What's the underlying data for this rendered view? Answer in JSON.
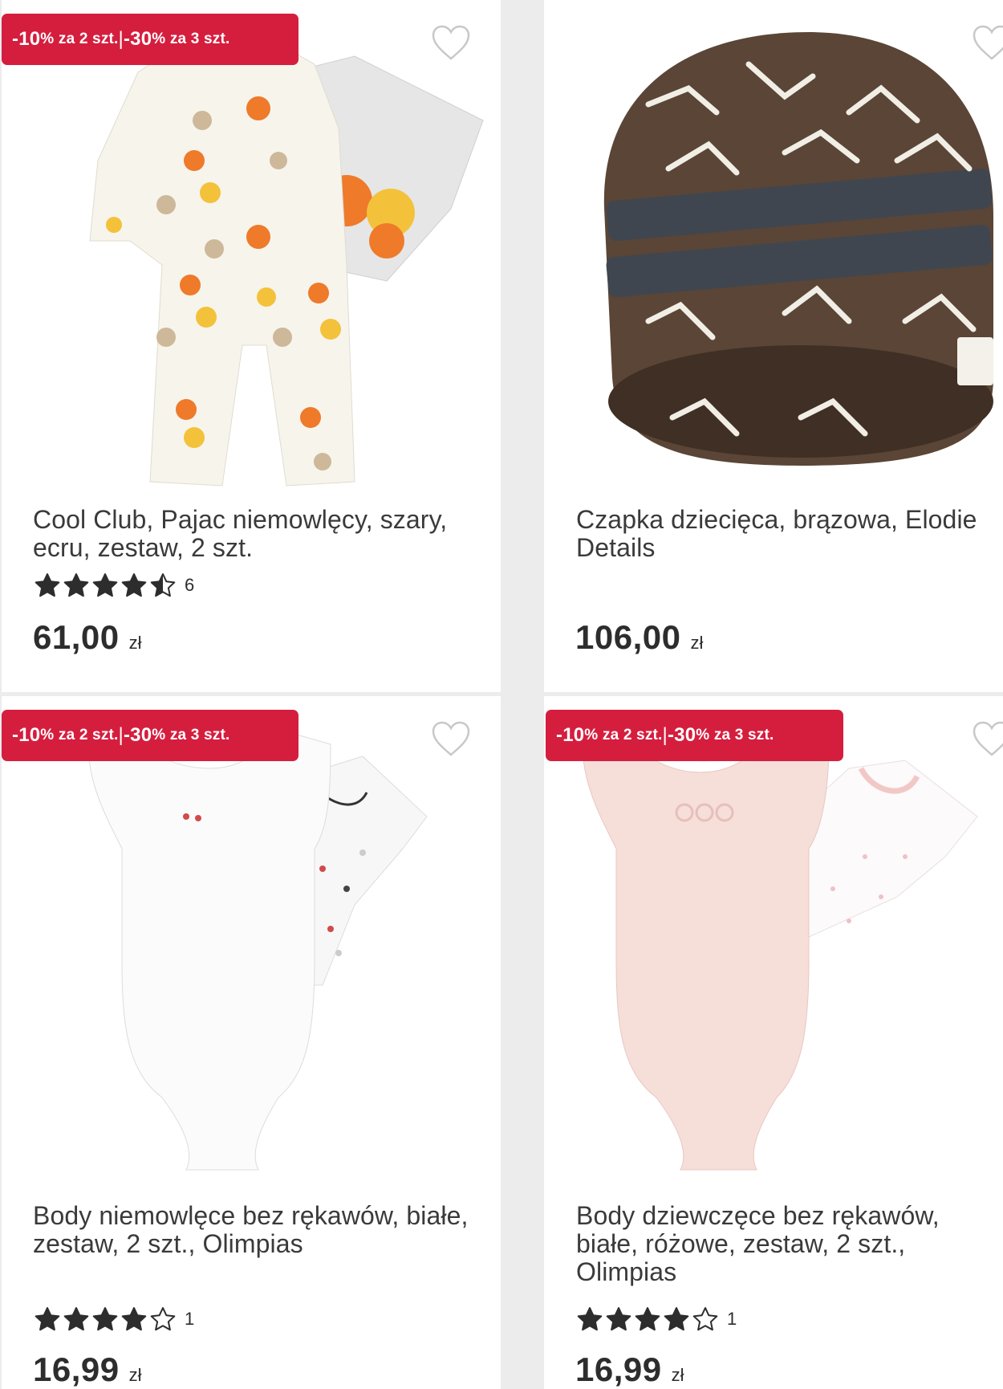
{
  "products": [
    {
      "badge": {
        "part1_pct": "-10",
        "part1_rest": "% za 2 szt.",
        "sep": " | ",
        "part2_pct": "-30",
        "part2_rest": "% za 3 szt."
      },
      "title": "Cool Club, Pajac niemowlęcy, szary, ecru, zestaw, 2 szt.",
      "rating": 4.5,
      "rating_count": "6",
      "price": "61,00",
      "currency": "zł"
    },
    {
      "title": "Czapka dziecięca, brązowa, Elodie Details",
      "price": "106,00",
      "currency": "zł"
    },
    {
      "badge": {
        "part1_pct": "-10",
        "part1_rest": "% za 2 szt.",
        "sep": " | ",
        "part2_pct": "-30",
        "part2_rest": "% za 3 szt."
      },
      "title": "Body niemowlęce bez rękawów, białe, zestaw, 2 szt., Olimpias",
      "rating": 4,
      "rating_count": "1",
      "price": "16,99",
      "currency": "zł"
    },
    {
      "badge": {
        "part1_pct": "-10",
        "part1_rest": "% za 2 szt.",
        "sep": " | ",
        "part2_pct": "-30",
        "part2_rest": "% za 3 szt."
      },
      "title": "Body dziewczęce bez rękawów, białe, różowe, zestaw, 2 szt., Olimpias",
      "rating": 4,
      "rating_count": "1",
      "price": "16,99",
      "currency": "zł"
    }
  ],
  "colors": {
    "badge": "#d51e3e",
    "star": "#2d2d2d",
    "heart": "#c8c8c8"
  }
}
